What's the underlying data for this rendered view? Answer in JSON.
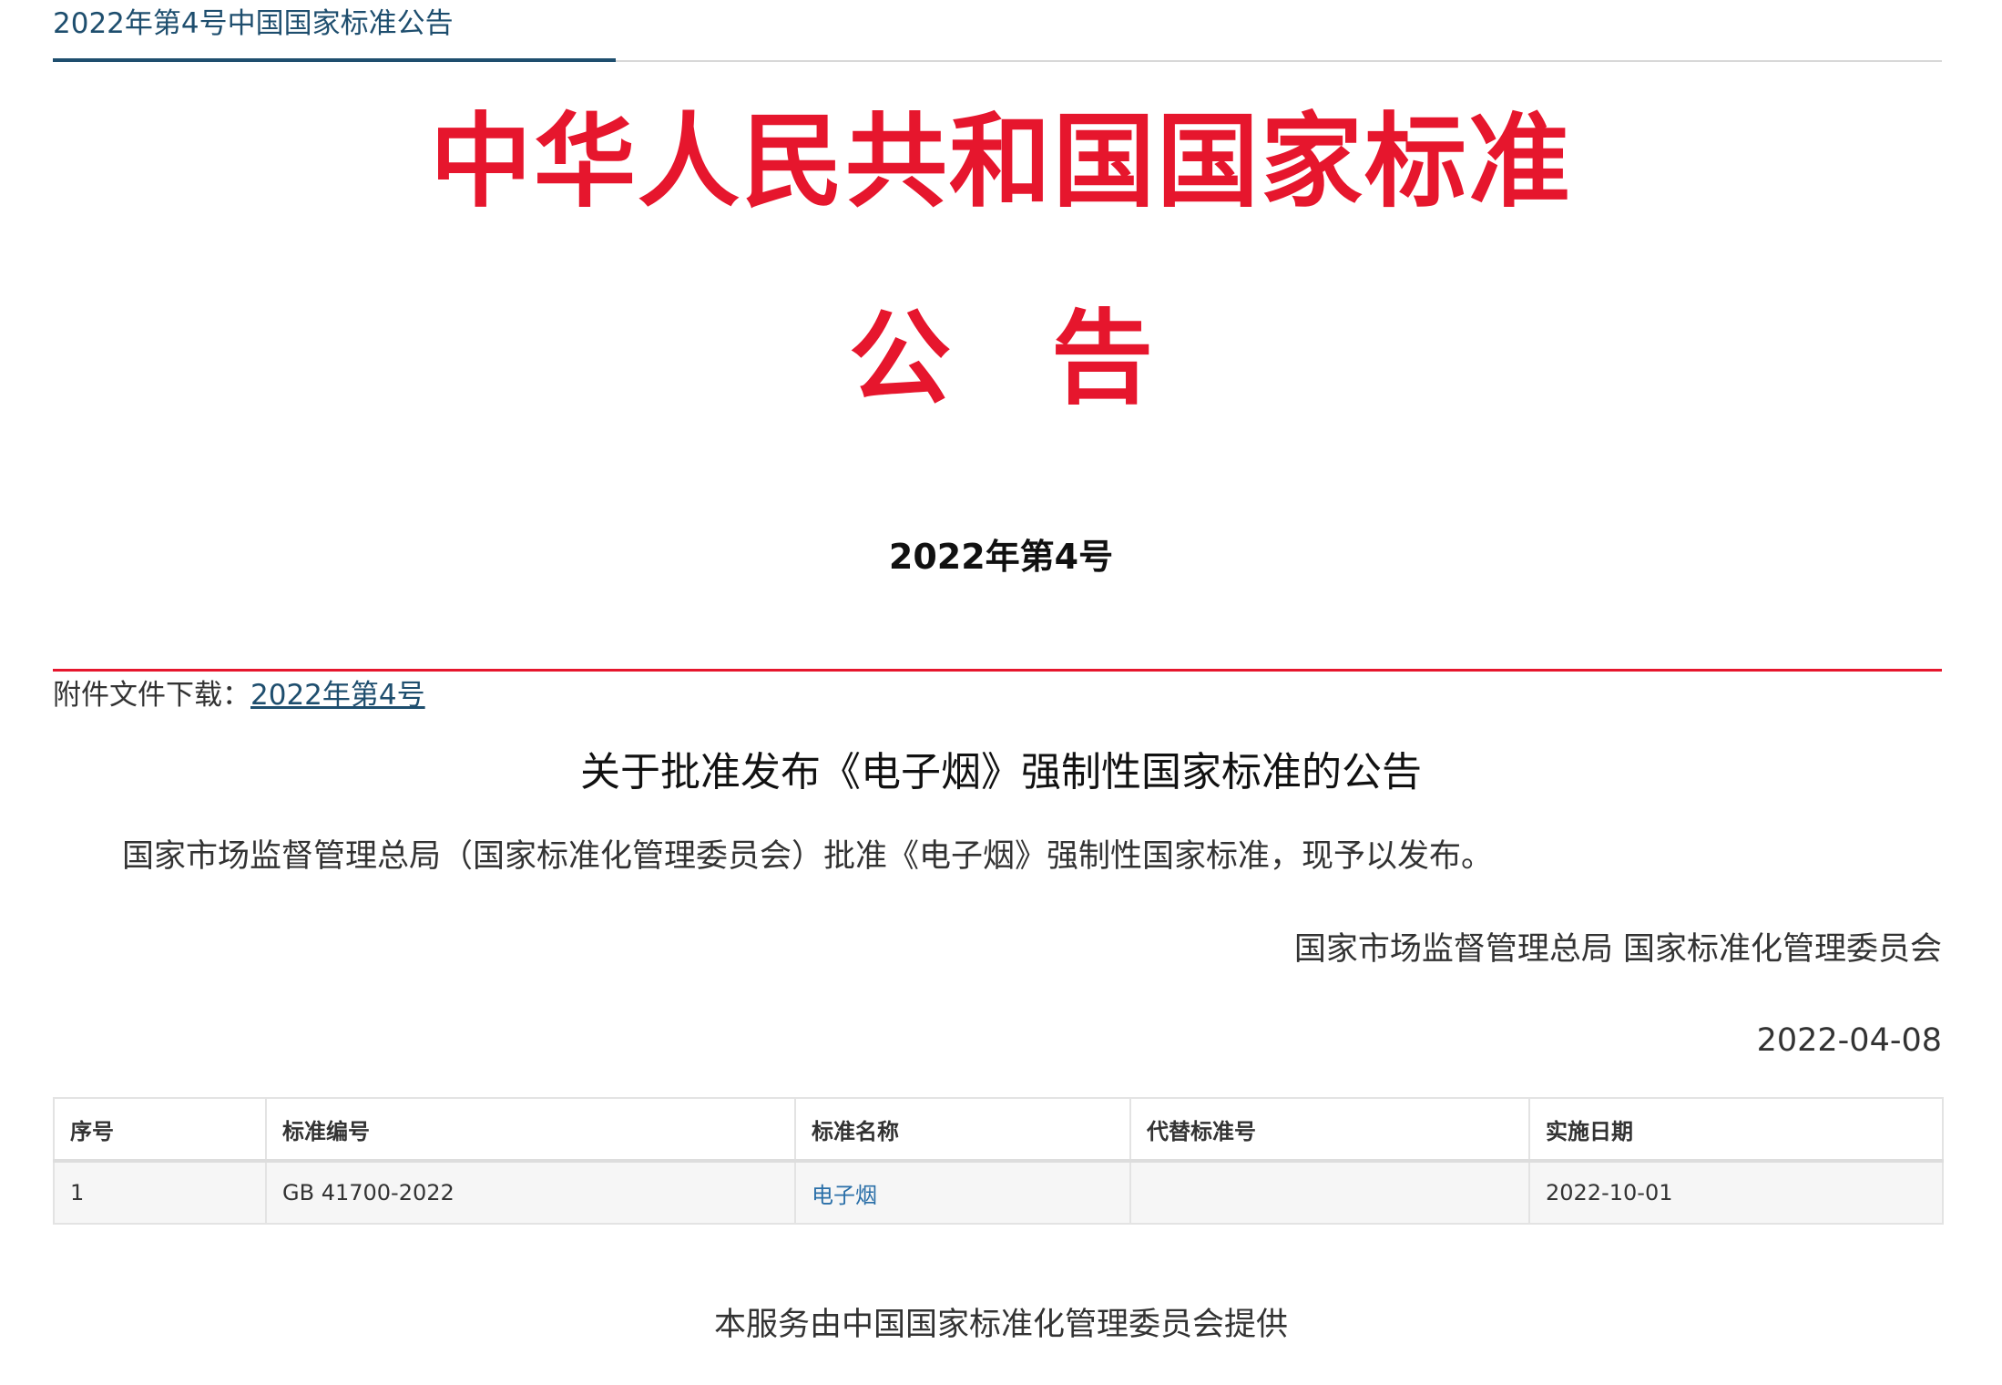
{
  "header": {
    "page_title": "2022年第4号中国国家标准公告"
  },
  "announcement": {
    "heading": "中华人民共和国国家标准",
    "notice_char_1": "公",
    "notice_char_2": "告",
    "issue_number": "2022年第4号"
  },
  "attachment": {
    "label": "附件文件下载：",
    "link_text": "2022年第4号"
  },
  "document": {
    "title": "关于批准发布《电子烟》强制性国家标准的公告",
    "body": "国家市场监督管理总局（国家标准化管理委员会）批准《电子烟》强制性国家标准，现予以发布。",
    "signatory": "国家市场监督管理总局 国家标准化管理委员会",
    "date": "2022-04-08"
  },
  "table": {
    "headers": [
      "序号",
      "标准编号",
      "标准名称",
      "代替标准号",
      "实施日期"
    ],
    "rows": [
      [
        "1",
        "GB 41700-2022",
        "电子烟",
        "",
        "2022-10-01"
      ]
    ]
  },
  "footer": {
    "text": "本服务由中国国家标准化管理委员会提供"
  },
  "colors": {
    "heading_red": "#e6162d",
    "nav_blue": "#1e4e6e",
    "link_blue": "#2a6fa8"
  }
}
